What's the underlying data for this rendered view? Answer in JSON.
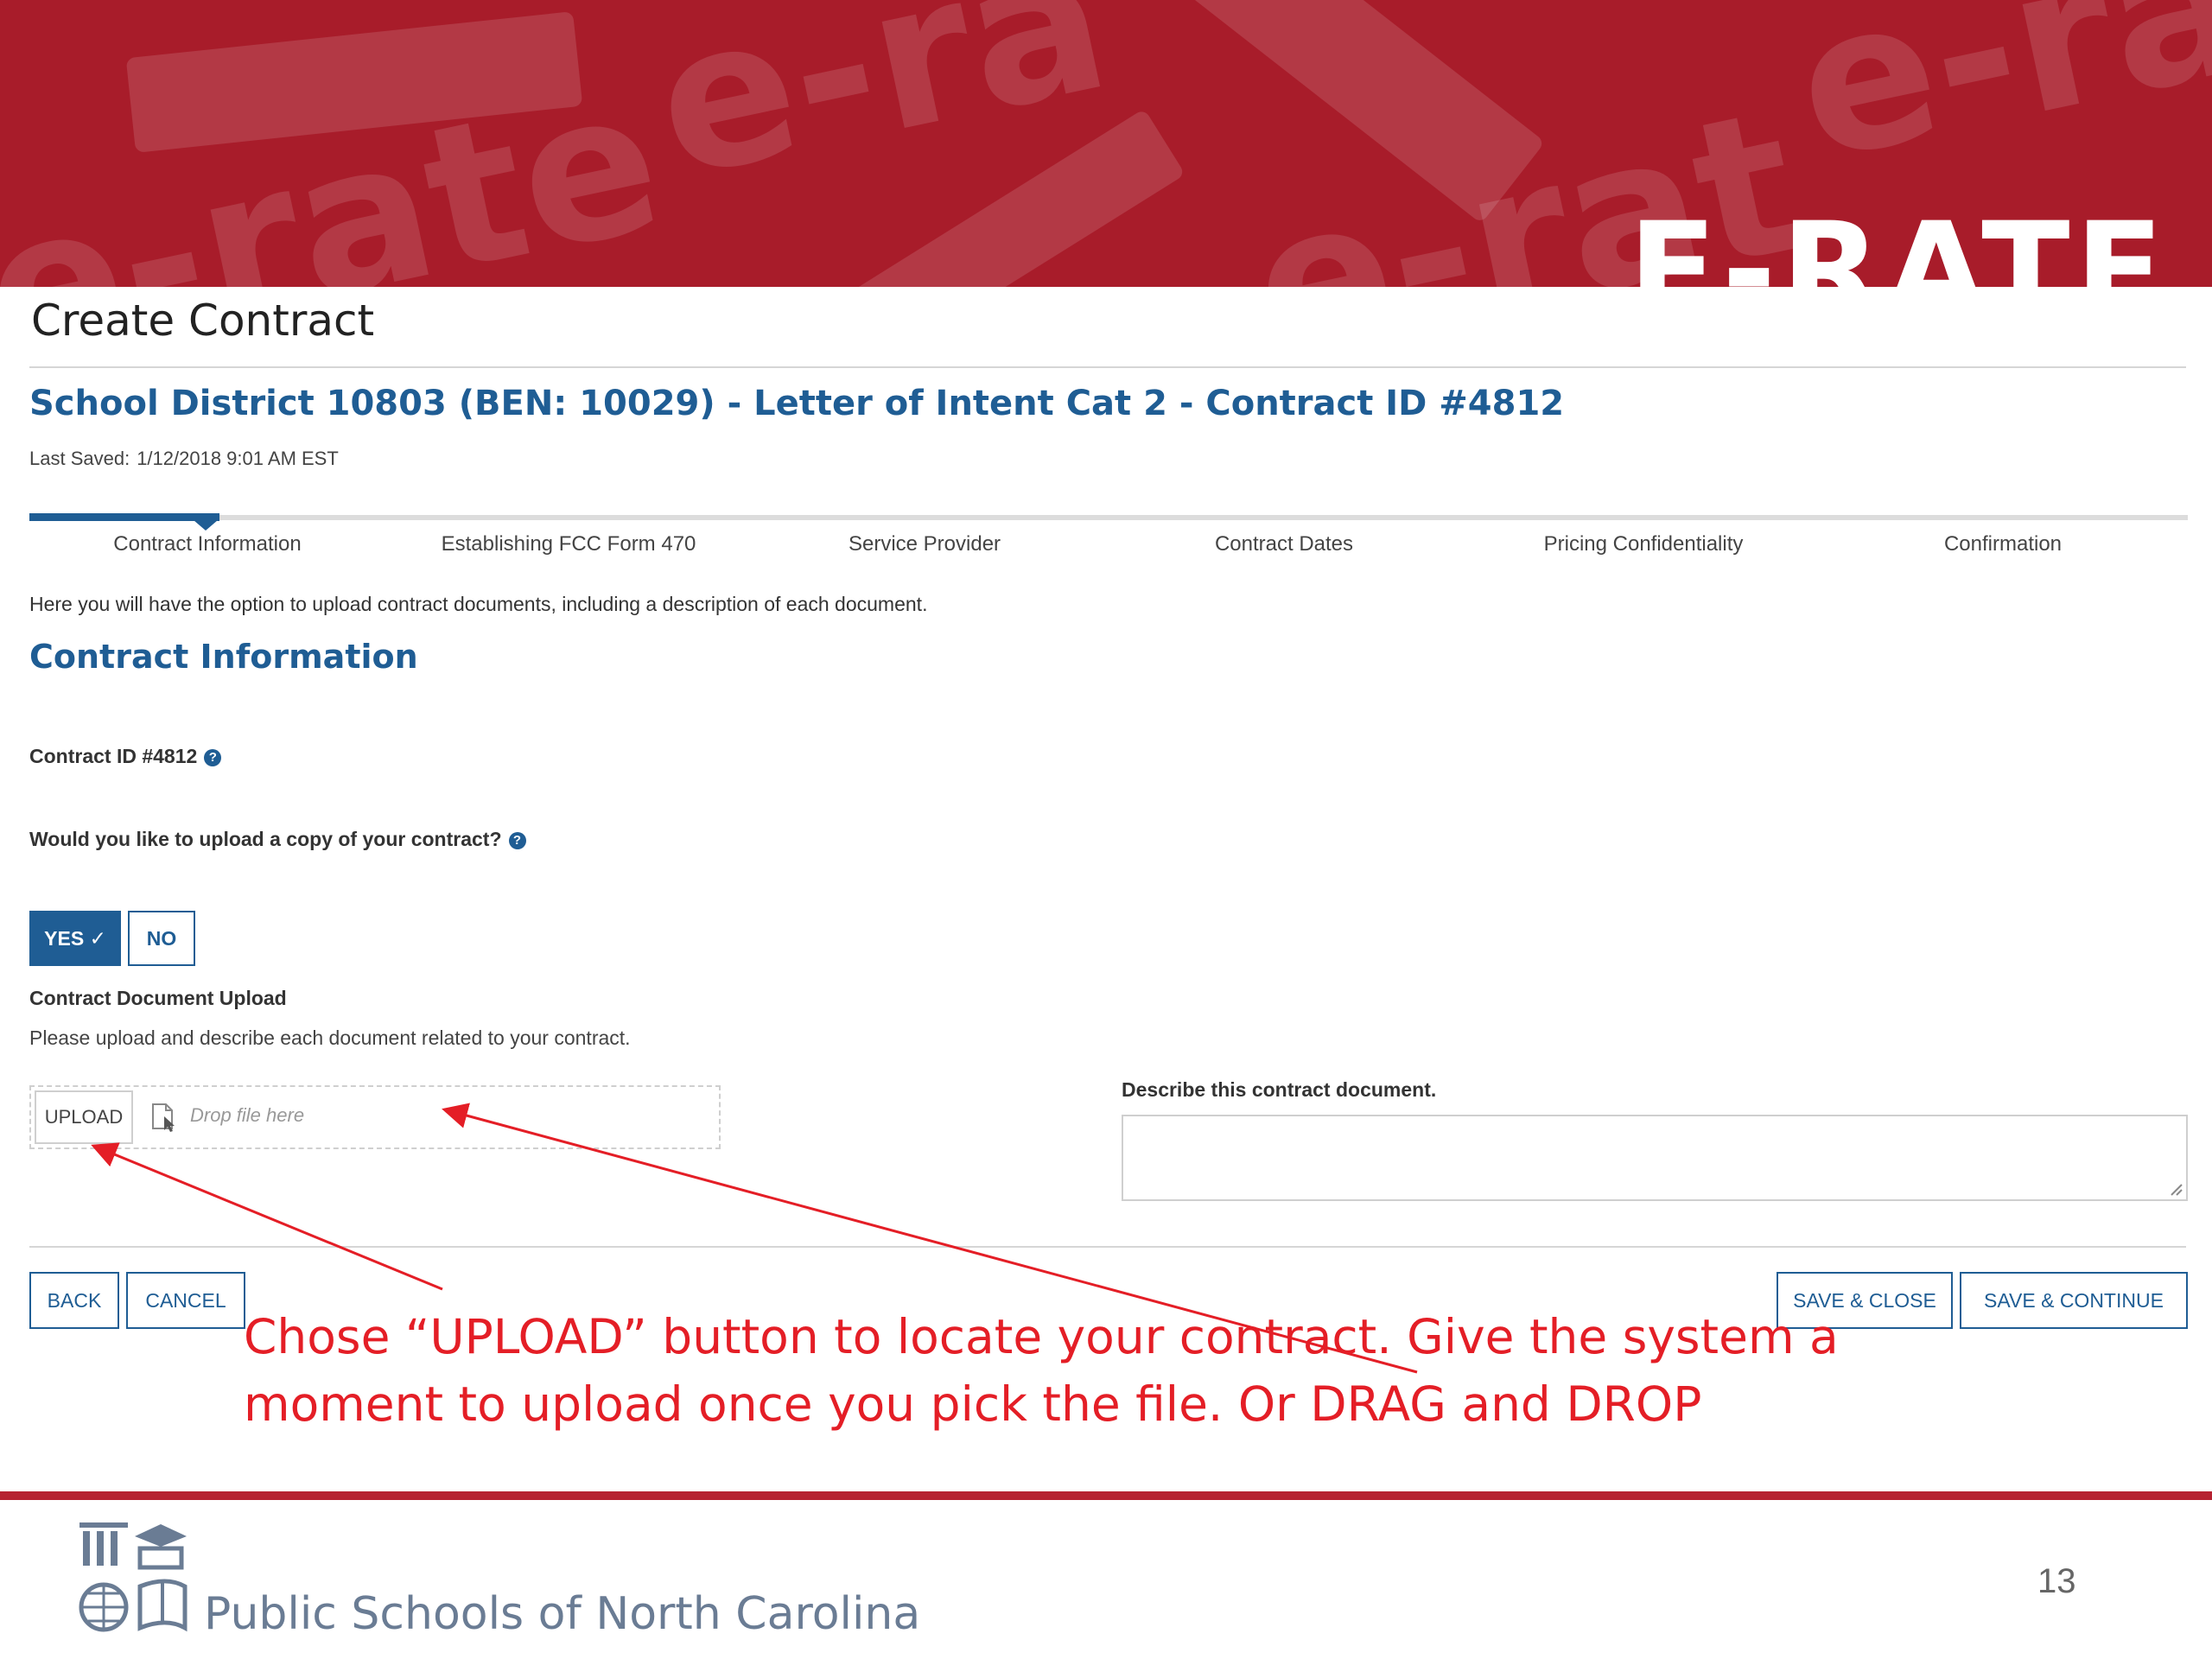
{
  "banner": {
    "brand": "E-RATE",
    "watermark": [
      "e-rate",
      "e-ra",
      "e-rat",
      "e-ra"
    ]
  },
  "header": {
    "page_title": "Create Contract",
    "subtitle": "School District 10803 (BEN: 10029) - Letter of Intent Cat 2 - Contract ID #4812",
    "last_saved_label": "Last Saved:",
    "last_saved_value": "1/12/2018 9:01 AM EST"
  },
  "stepper": {
    "steps": [
      {
        "label": "Contract Information"
      },
      {
        "label": "Establishing FCC Form 470"
      },
      {
        "label": "Service Provider"
      },
      {
        "label": "Contract Dates"
      },
      {
        "label": "Pricing Confidentiality"
      },
      {
        "label": "Confirmation"
      }
    ],
    "active_step": "Contract Information"
  },
  "main": {
    "intro": "Here you will have the option to upload contract documents, including a description of each document.",
    "section_title": "Contract Information",
    "contract_id_label": "Contract ID #4812",
    "upload_question": "Would you like to upload a copy of your contract?",
    "yes_label": "YES ✓",
    "no_label": "NO",
    "selected_answer": "YES",
    "doc_upload_heading": "Contract Document Upload",
    "doc_upload_hint": "Please upload and describe each document related to your contract.",
    "upload_button": "UPLOAD",
    "drop_placeholder": "Drop file here",
    "description_label": "Describe this contract document.",
    "description_value": ""
  },
  "actions": {
    "back": "BACK",
    "cancel": "CANCEL",
    "save_close": "SAVE & CLOSE",
    "save_continue": "SAVE & CONTINUE"
  },
  "annotation": {
    "line1": "Chose “UPLOAD” button to locate your contract. Give the system a",
    "line2": "moment to upload once you pick the file. Or DRAG and DROP"
  },
  "footer": {
    "org": "Public Schools of North Carolina",
    "page_number": "13"
  },
  "colors": {
    "banner_red": "#a81c2a",
    "primary_blue": "#1f5d94",
    "annotation_red": "#e41e26"
  }
}
